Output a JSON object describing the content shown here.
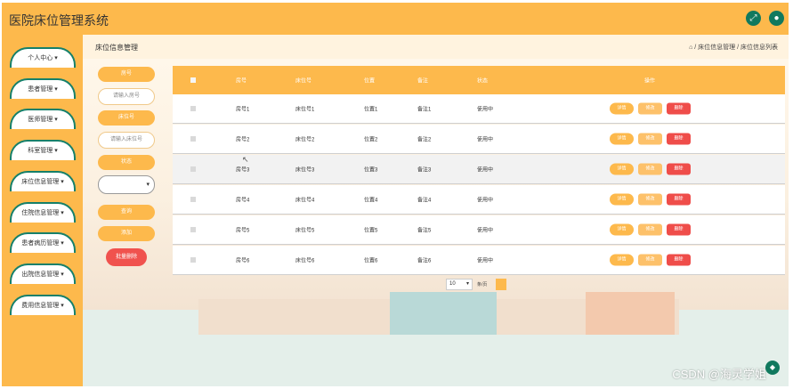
{
  "app": {
    "title": "医院床位管理系统"
  },
  "header": {
    "icons": [
      "expand-icon",
      "user-icon"
    ]
  },
  "sidebar": {
    "items": [
      {
        "label": "个人中心 ▾"
      },
      {
        "label": "患者管理 ▾"
      },
      {
        "label": "医师管理 ▾"
      },
      {
        "label": "科室管理 ▾"
      },
      {
        "label": "床位信息管理 ▾"
      },
      {
        "label": "住院信息管理 ▾"
      },
      {
        "label": "患者病历管理 ▾"
      },
      {
        "label": "出院信息管理 ▾"
      },
      {
        "label": "费用信息管理 ▾"
      }
    ]
  },
  "page": {
    "title": "床位信息管理",
    "breadcrumb": "/ 床位信息管理 / 床位信息列表"
  },
  "filters": {
    "room_label": "房号",
    "room_placeholder": "请输入房号",
    "bed_label": "床位号",
    "bed_placeholder": "请输入床位号",
    "status_label": "状态",
    "status_value": "",
    "query_button": "查询",
    "add_button": "添加",
    "batch_delete_button": "批量删除"
  },
  "table": {
    "headers": [
      "房号",
      "床位号",
      "位置",
      "备注",
      "状态",
      "操作"
    ],
    "rows": [
      [
        "房号1",
        "床位号1",
        "位置1",
        "备注1",
        "使用中"
      ],
      [
        "房号2",
        "床位号2",
        "位置2",
        "备注2",
        "使用中"
      ],
      [
        "房号3",
        "床位号3",
        "位置3",
        "备注3",
        "使用中"
      ],
      [
        "房号4",
        "床位号4",
        "位置4",
        "备注4",
        "使用中"
      ],
      [
        "房号5",
        "床位号5",
        "位置5",
        "备注5",
        "使用中"
      ],
      [
        "房号6",
        "床位号6",
        "位置6",
        "备注6",
        "使用中"
      ]
    ],
    "actions": {
      "detail": "详情",
      "edit": "修改",
      "delete": "删除"
    }
  },
  "pagination": {
    "page_size": "10",
    "per_page_label": "条/页"
  },
  "watermark": "CSDN @海灵学姐",
  "colors": {
    "primary": "#fdb94c",
    "danger": "#ef4d4a",
    "accent": "#11795e"
  }
}
